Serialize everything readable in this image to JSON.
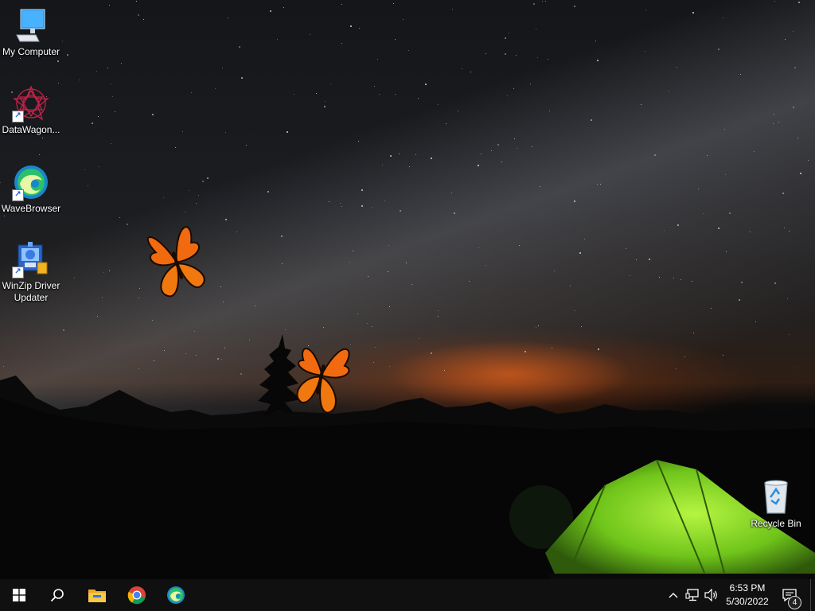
{
  "desktop": {
    "icons": [
      {
        "label": "My Computer",
        "icon": "computer-icon",
        "shortcut": false
      },
      {
        "label": "DataWagon...",
        "icon": "datawagon-icon",
        "shortcut": true
      },
      {
        "label": "WaveBrowser",
        "icon": "wavebrowser-icon",
        "shortcut": true
      },
      {
        "label": "WinZip Driver Updater",
        "icon": "winzip-driver-updater-icon",
        "shortcut": true
      },
      {
        "label": "Recycle Bin",
        "icon": "recycle-bin-icon",
        "shortcut": false
      }
    ]
  },
  "taskbar": {
    "start": "windows-start-icon",
    "search": "search-icon",
    "pinned": [
      {
        "name": "file-explorer-icon"
      },
      {
        "name": "chrome-icon"
      },
      {
        "name": "wavebrowser-taskbar-icon"
      }
    ],
    "tray": {
      "icons": [
        "chevron-up-icon",
        "network-icon",
        "volume-icon"
      ],
      "time": "6:53 PM",
      "date": "5/30/2022",
      "notification_count": "4"
    }
  },
  "colors": {
    "taskbar_bg": "#101010",
    "tent": "#7cd81e",
    "butterfly": "#f26a0f"
  }
}
